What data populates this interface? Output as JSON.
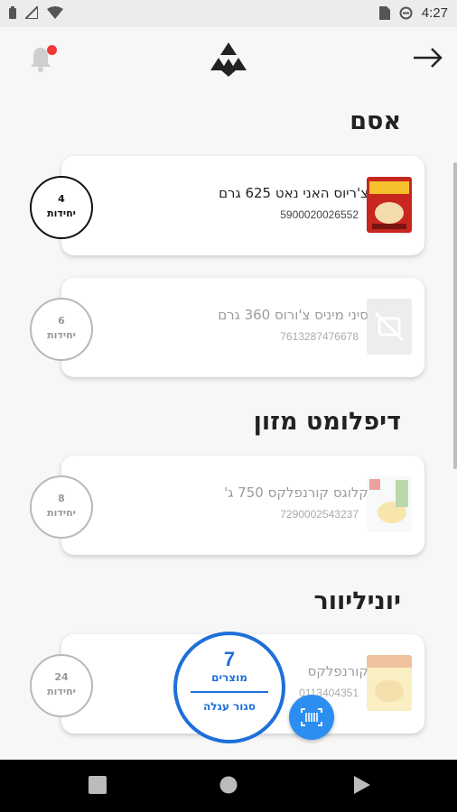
{
  "status_bar": {
    "time": "4:27"
  },
  "header": {
    "notification_badge": true
  },
  "sections": [
    {
      "title": "אסם",
      "items": [
        {
          "name": "צ'ריוס האני נאט 625 גרם",
          "code": "5900020026552",
          "quantity": "4",
          "unit": "יחידות",
          "active": true
        },
        {
          "name": "סיני מיניס צ'ורוס 360 גרם",
          "code": "7613287476678",
          "quantity": "6",
          "unit": "יחידות",
          "active": false
        }
      ]
    },
    {
      "title": "דיפלומט מזון",
      "items": [
        {
          "name": "קלוגס קורנפלקס 750 ג'",
          "code": "7290002543237",
          "quantity": "8",
          "unit": "יחידות",
          "active": false
        }
      ]
    },
    {
      "title": "יוניליוור",
      "items": [
        {
          "name": "קורנפלקס",
          "code": "0113404351",
          "quantity": "24",
          "unit": "יחידות",
          "active": false
        }
      ]
    }
  ],
  "cart": {
    "count": "7",
    "label": "מוצרים",
    "close_label": "סגור עגלה"
  },
  "colors": {
    "accent": "#1e6fd9",
    "scan_button": "#2b8ef0",
    "badge": "#f03a3a"
  }
}
